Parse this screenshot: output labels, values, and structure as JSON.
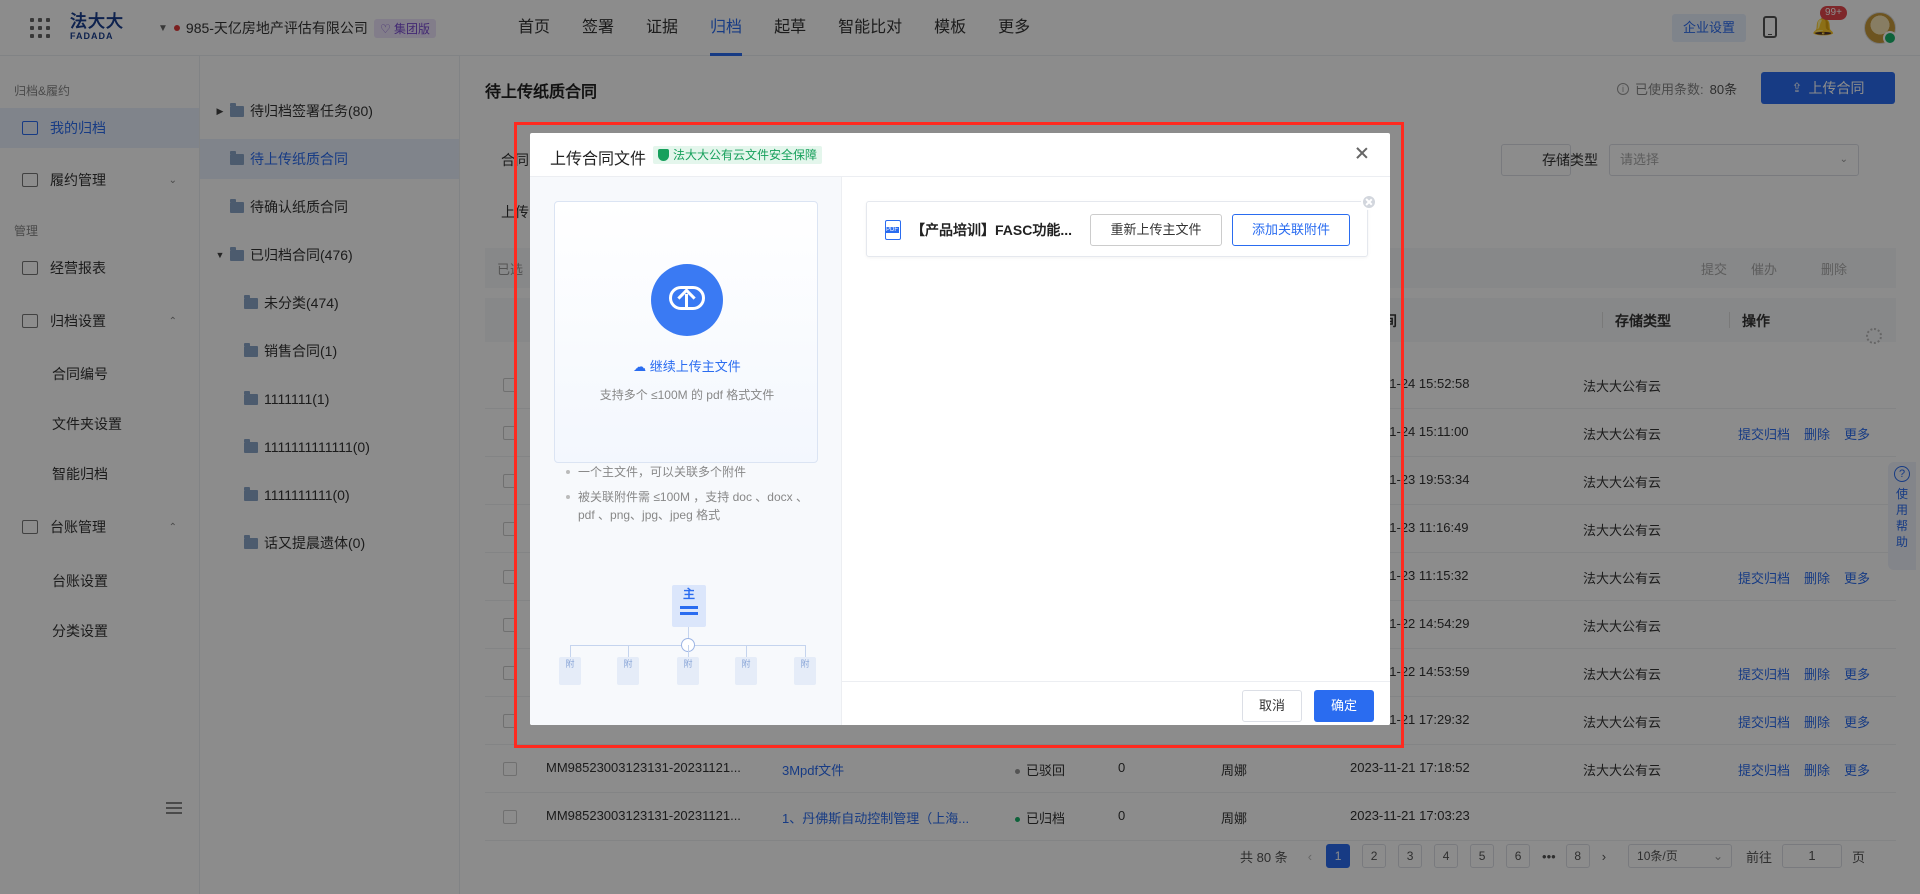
{
  "app": {
    "logo_text": "法大大",
    "logo_sub": "FADADA",
    "company": "985-天亿房地产评估有限公司",
    "company_tag": "集团版",
    "nav": [
      "首页",
      "签署",
      "证据",
      "归档",
      "起草",
      "智能比对",
      "模板",
      "更多"
    ],
    "nav_active": "归档",
    "enterprise_settings": "企业设置",
    "notification_count": "99+"
  },
  "sidebar": {
    "group1": "归档&履约",
    "my_archive": "我的归档",
    "performance": "履约管理",
    "group2": "管理",
    "reports": "经营报表",
    "archive_settings": "归档设置",
    "archive_sub": [
      "合同编号",
      "文件夹设置",
      "智能归档"
    ],
    "ledger": "台账管理",
    "ledger_sub": [
      "台账设置",
      "分类设置"
    ]
  },
  "tree": {
    "items": [
      "待归档签署任务(80)",
      "待上传纸质合同",
      "待确认纸质合同",
      "已归档合同(476)",
      "未分类(474)",
      "销售合同(1)",
      "1111111(1)",
      "1111111111111(0)",
      "1111111111(0)",
      "话又提晨遗体(0)"
    ],
    "active_index": 1
  },
  "main": {
    "title": "待上传纸质合同",
    "used_label": "已使用条数:",
    "used_value": "80条",
    "upload_button": "上传合同",
    "filter_contract_label": "合同",
    "filter_upload_label": "上传",
    "storage_label": "存储类型",
    "storage_placeholder": "请选择",
    "toolbar_selected": "已选",
    "toolbar_actions": [
      "提交",
      "催办",
      "删除"
    ],
    "col_time": "间",
    "col_storage": "存储类型",
    "col_action": "操作",
    "rows": [
      {
        "id": "",
        "name": "",
        "status": "",
        "status_ok": false,
        "count": "",
        "user": "",
        "time": "11-24 15:52:58",
        "storage": "法大大公有云",
        "actions": []
      },
      {
        "id": "",
        "name": "",
        "status": "",
        "status_ok": false,
        "count": "",
        "user": "",
        "time": "11-24 15:11:00",
        "storage": "法大大公有云",
        "actions": [
          "提交归档",
          "删除",
          "更多"
        ]
      },
      {
        "id": "",
        "name": "",
        "status": "",
        "status_ok": false,
        "count": "",
        "user": "",
        "time": "11-23 19:53:34",
        "storage": "法大大公有云",
        "actions": []
      },
      {
        "id": "",
        "name": "",
        "status": "",
        "status_ok": false,
        "count": "",
        "user": "",
        "time": "11-23 11:16:49",
        "storage": "法大大公有云",
        "actions": []
      },
      {
        "id": "",
        "name": "",
        "status": "",
        "status_ok": false,
        "count": "",
        "user": "",
        "time": "11-23 11:15:32",
        "storage": "法大大公有云",
        "actions": [
          "提交归档",
          "删除",
          "更多"
        ]
      },
      {
        "id": "",
        "name": "",
        "status": "",
        "status_ok": false,
        "count": "",
        "user": "",
        "time": "11-22 14:54:29",
        "storage": "法大大公有云",
        "actions": []
      },
      {
        "id": "",
        "name": "",
        "status": "",
        "status_ok": false,
        "count": "",
        "user": "",
        "time": "11-22 14:53:59",
        "storage": "法大大公有云",
        "actions": [
          "提交归档",
          "删除",
          "更多"
        ]
      },
      {
        "id": "",
        "name": "",
        "status": "",
        "status_ok": false,
        "count": "",
        "user": "",
        "time": "11-21 17:29:32",
        "storage": "法大大公有云",
        "actions": [
          "提交归档",
          "删除",
          "更多"
        ]
      },
      {
        "id": "MM98523003123131-20231121...",
        "name": "3Mpdf文件",
        "status": "已驳回",
        "status_ok": false,
        "count": "0",
        "user": "周娜",
        "time": "2023-11-21 17:18:52",
        "storage": "法大大公有云",
        "actions": [
          "提交归档",
          "删除",
          "更多"
        ]
      },
      {
        "id": "MM98523003123131-20231121...",
        "name": "1、丹佛斯自动控制管理（上海...",
        "status": "已归档",
        "status_ok": true,
        "count": "0",
        "user": "周娜",
        "time": "2023-11-21 17:03:23",
        "storage": "",
        "actions": []
      }
    ],
    "pager": {
      "total": "共 80 条",
      "pages": [
        "1",
        "2",
        "3",
        "4",
        "5",
        "6",
        "•••",
        "8"
      ],
      "current": "1",
      "size": "10条/页",
      "goto_label": "前往",
      "goto_value": "1",
      "page_unit": "页"
    },
    "help": "使用帮助"
  },
  "modal": {
    "title": "上传合同文件",
    "secure_tag": "法大大公有云文件安全保障",
    "continue_upload": "继续上传主文件",
    "dropzone_hint": "支持多个 ≤100M 的 pdf 格式文件",
    "notes": [
      "一个主文件，可以关联多个附件",
      "被关联附件需 ≤100M ，支持 doc 、docx 、pdf 、png、jpg、jpeg 格式"
    ],
    "diagram_main": "主",
    "diagram_attach": "附",
    "file_name": "【产品培训】FASC功能...",
    "reupload_button": "重新上传主文件",
    "add_attachment_button": "添加关联附件",
    "cancel_button": "取消",
    "confirm_button": "确定"
  },
  "colors": {
    "primary": "#2a6cf0",
    "highlight_frame": "#ff2a1f",
    "secure_green": "#17a05c"
  }
}
